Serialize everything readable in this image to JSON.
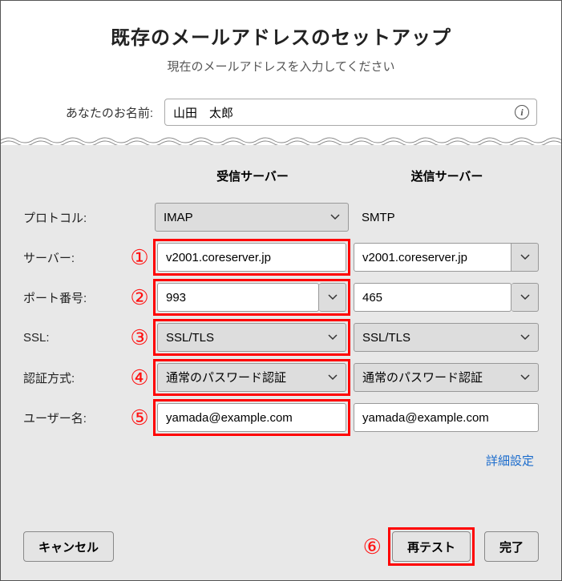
{
  "header": {
    "title": "既存のメールアドレスのセットアップ",
    "subtitle": "現在のメールアドレスを入力してください"
  },
  "name_row": {
    "label": "あなたのお名前:",
    "value": "山田　太郎"
  },
  "cols": {
    "incoming": "受信サーバー",
    "outgoing": "送信サーバー"
  },
  "rows": {
    "protocol": {
      "label": "プロトコル:",
      "in_value": "IMAP",
      "out_value": "SMTP"
    },
    "server": {
      "label": "サーバー:",
      "num": "①",
      "in_value": "v2001.coreserver.jp",
      "out_value": "v2001.coreserver.jp"
    },
    "port": {
      "label": "ポート番号:",
      "num": "②",
      "in_value": "993",
      "out_value": "465"
    },
    "ssl": {
      "label": "SSL:",
      "num": "③",
      "in_value": "SSL/TLS",
      "out_value": "SSL/TLS"
    },
    "auth": {
      "label": "認証方式:",
      "num": "④",
      "in_value": "通常のパスワード認証",
      "out_value": "通常のパスワード認証"
    },
    "user": {
      "label": "ユーザー名:",
      "num": "⑤",
      "in_value": "yamada@example.com",
      "out_value": "yamada@example.com"
    }
  },
  "adv_link": "詳細設定",
  "footer": {
    "cancel": "キャンセル",
    "retest_num": "⑥",
    "retest": "再テスト",
    "done": "完了"
  }
}
